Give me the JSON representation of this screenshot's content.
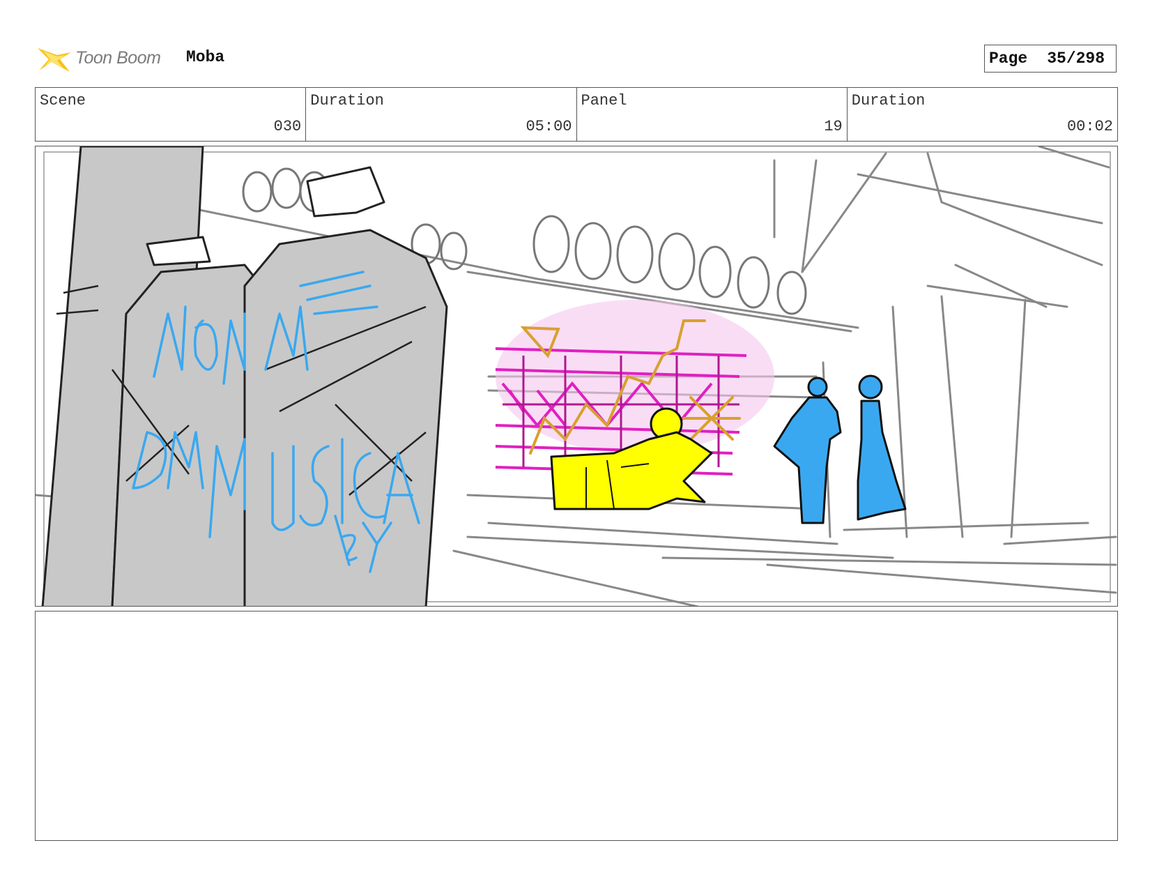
{
  "header": {
    "logo_text": "Toon Boom",
    "project_name": "Moba",
    "page_label": "Page",
    "page_value": "35/298"
  },
  "info": [
    {
      "label": "Scene",
      "value": "030"
    },
    {
      "label": "Duration",
      "value": "05:00"
    },
    {
      "label": "Panel",
      "value": "19"
    },
    {
      "label": "Duration",
      "value": "00:02"
    }
  ],
  "colors": {
    "logo_flash": "#f7c21a",
    "sketch_gray": "#c8c8c8",
    "graffiti_blue": "#3aa8f0",
    "figure_yellow": "#ffff00",
    "mural_pink": "#e020c0",
    "mural_gold": "#d8a030"
  },
  "panel": {
    "description_icon": "storyboard-sketch"
  },
  "notes": {
    "text": ""
  }
}
